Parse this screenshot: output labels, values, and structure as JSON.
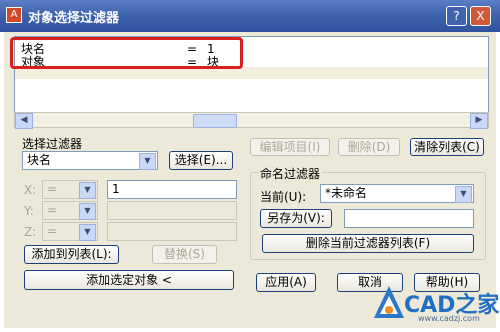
{
  "window": {
    "title": "对象选择过滤器",
    "help_glyph": "?",
    "close_glyph": "X"
  },
  "filter_list": {
    "rows": [
      {
        "name": "块名",
        "op": "=",
        "value": "1"
      },
      {
        "name": "对象",
        "op": "=",
        "value": "块"
      }
    ]
  },
  "select_filter": {
    "group_label": "选择过滤器",
    "type_value": "块名",
    "select_button": "选择(E)...",
    "x_label": "X:",
    "y_label": "Y:",
    "z_label": "Z:",
    "x_op": "=",
    "y_op": "=",
    "z_op": "=",
    "x_value": "1",
    "add_to_list_button": "添加到列表(L):",
    "replace_button": "替换(S)",
    "add_selected_button": "添加选定对象 <"
  },
  "list_actions": {
    "edit_button": "编辑项目(I)",
    "delete_button": "删除(D)",
    "clear_button": "清除列表(C)"
  },
  "named_filters": {
    "group_label": "命名过滤器",
    "current_label": "当前(U):",
    "current_value": "*未命名",
    "save_as_button": "另存为(V):",
    "delete_current_button": "删除当前过滤器列表(F)"
  },
  "footer": {
    "apply": "应用(A)",
    "cancel": "取消",
    "help": "帮助(H)"
  },
  "watermark": {
    "text": "CAD之家",
    "url": "www.cadzj.com"
  }
}
